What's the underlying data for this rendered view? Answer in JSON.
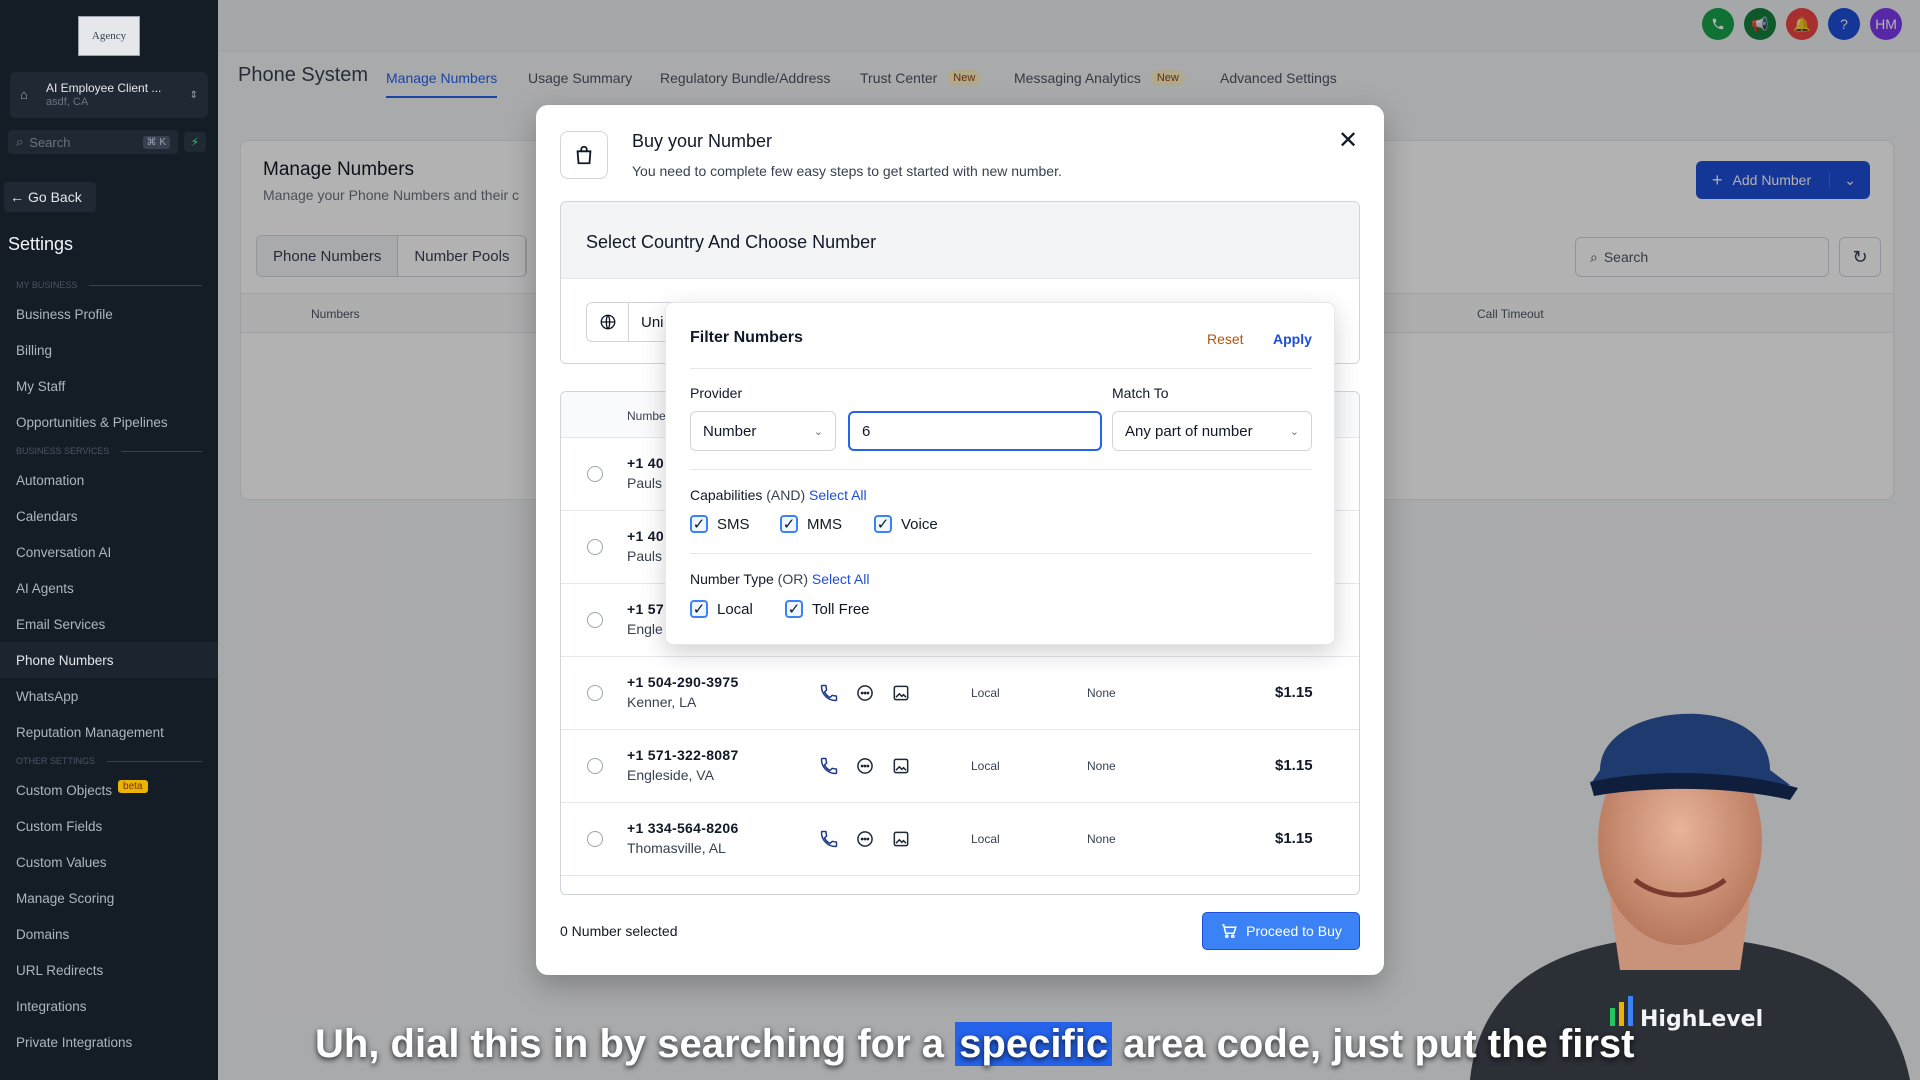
{
  "sidebar": {
    "logo_text": "Agency",
    "account_name": "AI Employee Client ...",
    "account_location": "asdf, CA",
    "search_placeholder": "Search",
    "search_shortcut": "⌘ K",
    "go_back": "Go Back",
    "settings_title": "Settings",
    "sections": [
      {
        "label": "MY BUSINESS",
        "items": [
          "Business Profile",
          "Billing",
          "My Staff",
          "Opportunities & Pipelines"
        ]
      },
      {
        "label": "BUSINESS SERVICES",
        "items": [
          "Automation",
          "Calendars",
          "Conversation AI",
          "AI Agents",
          "Email Services",
          "Phone Numbers",
          "WhatsApp",
          "Reputation Management"
        ]
      },
      {
        "label": "OTHER SETTINGS",
        "items": [
          "Custom Objects",
          "Custom Fields",
          "Custom Values",
          "Manage Scoring",
          "Domains",
          "URL Redirects",
          "Integrations",
          "Private Integrations"
        ]
      }
    ],
    "active_item": "Phone Numbers",
    "beta_badge": "beta"
  },
  "topbar": {
    "avatar_initials": "HM",
    "colors": {
      "phone": "#16a34a",
      "megaphone": "#15803d",
      "bell": "#ef4444",
      "help": "#1d4ed8",
      "avatar": "#7c3aed"
    }
  },
  "tabs": {
    "page_title": "Phone System",
    "items": [
      {
        "label": "Manage Numbers",
        "active": true
      },
      {
        "label": "Usage Summary"
      },
      {
        "label": "Regulatory Bundle/Address"
      },
      {
        "label": "Trust Center",
        "badge": "New"
      },
      {
        "label": "Messaging Analytics",
        "badge": "New"
      },
      {
        "label": "Advanced Settings"
      }
    ]
  },
  "manage": {
    "title": "Manage Numbers",
    "subtitle": "Manage your Phone Numbers and their c",
    "segments": [
      "Phone Numbers",
      "Number Pools"
    ],
    "col_numbers": "Numbers",
    "col_call_timeout": "Call Timeout",
    "add_number": "Add Number",
    "search_placeholder": "Search"
  },
  "modal": {
    "title": "Buy your Number",
    "subtitle": "You need to complete few easy steps to get started with new number.",
    "step_title": "Select Country And Choose Number",
    "country_value": "Uni",
    "list_header_number": "Numbe",
    "rows": [
      {
        "number": "+1 40",
        "location": "Pauls"
      },
      {
        "number": "+1 40",
        "location": "Pauls"
      },
      {
        "number": "+1 57",
        "location": "Engle"
      },
      {
        "number": "+1 504-290-3975",
        "location": "Kenner, LA",
        "type": "Local",
        "address": "None",
        "price": "$1.15"
      },
      {
        "number": "+1 571-322-8087",
        "location": "Engleside, VA",
        "type": "Local",
        "address": "None",
        "price": "$1.15"
      },
      {
        "number": "+1 334-564-8206",
        "location": "Thomasville, AL",
        "type": "Local",
        "address": "None",
        "price": "$1.15"
      }
    ],
    "selected_text": "0 Number selected",
    "proceed": "Proceed to Buy"
  },
  "filter": {
    "title": "Filter Numbers",
    "reset": "Reset",
    "apply": "Apply",
    "provider_label": "Provider",
    "provider_value": "Number",
    "search_value": "6",
    "match_label": "Match To",
    "match_value": "Any part of number",
    "capabilities_label": "Capabilities",
    "capabilities_mode": "(AND)",
    "select_all": "Select All",
    "capabilities": [
      {
        "label": "SMS",
        "checked": true
      },
      {
        "label": "MMS",
        "checked": true
      },
      {
        "label": "Voice",
        "checked": true
      }
    ],
    "type_label": "Number Type",
    "type_mode": "(OR)",
    "types": [
      {
        "label": "Local",
        "checked": true
      },
      {
        "label": "Toll Free",
        "checked": true
      }
    ]
  },
  "webcam": {
    "brand": "HighLevel"
  },
  "caption": {
    "before": "Uh, dial this in by searching for a",
    "highlight": "specific",
    "after": "area code, just put the first"
  }
}
